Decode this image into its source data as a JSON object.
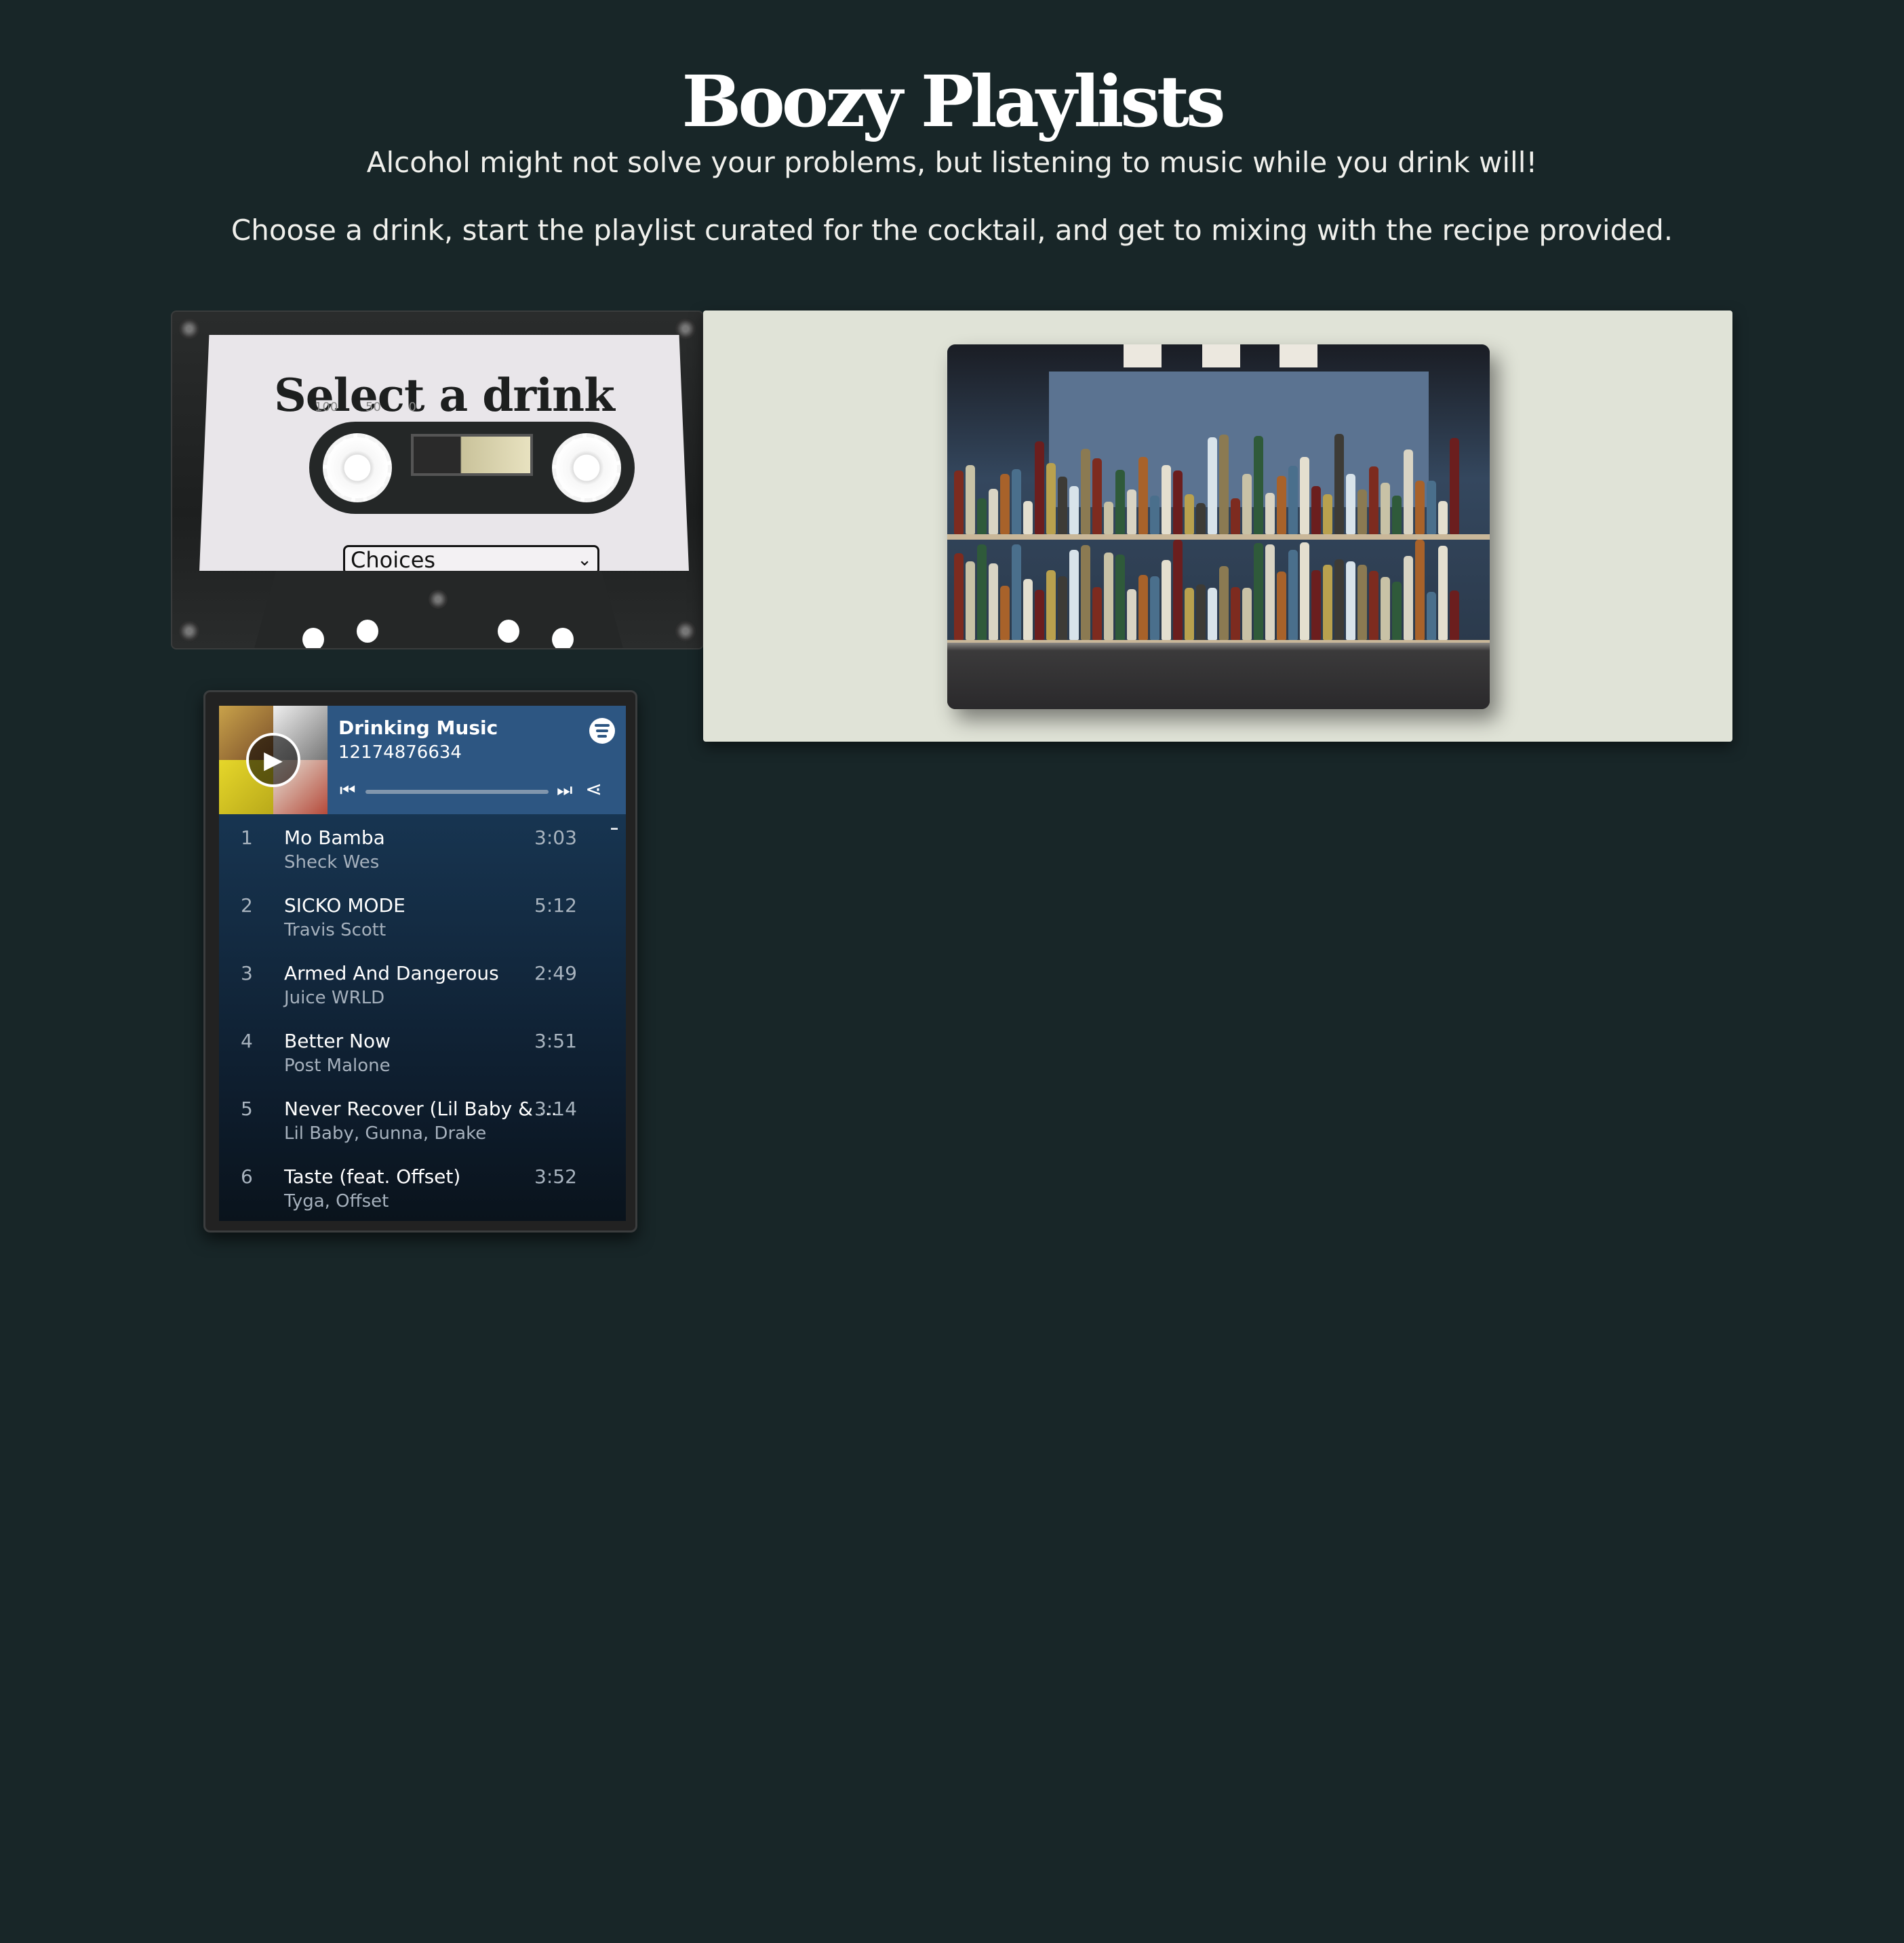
{
  "header": {
    "title": "Boozy Playlists",
    "tagline": "Alcohol might not solve your problems, but listening to music while you drink will!",
    "instructions": "Choose a drink, start the playlist curated for the cocktail, and get to mixing with the recipe provided."
  },
  "cassette": {
    "title": "Select a drink",
    "marks": [
      "100",
      "50",
      "0"
    ],
    "select": {
      "value": "Choices"
    }
  },
  "spotify": {
    "playlist_title": "Drinking Music",
    "owner": "12174876634",
    "tracks": [
      {
        "num": "1",
        "name": "Mo Bamba",
        "artist": "Sheck Wes",
        "duration": "3:03"
      },
      {
        "num": "2",
        "name": "SICKO MODE",
        "artist": "Travis Scott",
        "duration": "5:12"
      },
      {
        "num": "3",
        "name": "Armed And Dangerous",
        "artist": "Juice WRLD",
        "duration": "2:49"
      },
      {
        "num": "4",
        "name": "Better Now",
        "artist": "Post Malone",
        "duration": "3:51"
      },
      {
        "num": "5",
        "name": "Never Recover (Lil Baby & ...",
        "artist": "Lil Baby, Gunna, Drake",
        "duration": "3:14"
      },
      {
        "num": "6",
        "name": "Taste (feat. Offset)",
        "artist": "Tyga, Offset",
        "duration": "3:52"
      }
    ]
  },
  "colors": {
    "background": "#182628",
    "panel": "#e0e3d7",
    "spotify_header": "#2d5682"
  },
  "icons": [
    "play-icon",
    "spotify-logo-icon",
    "skip-back-icon",
    "skip-forward-icon",
    "share-icon",
    "chevron-down-icon"
  ]
}
